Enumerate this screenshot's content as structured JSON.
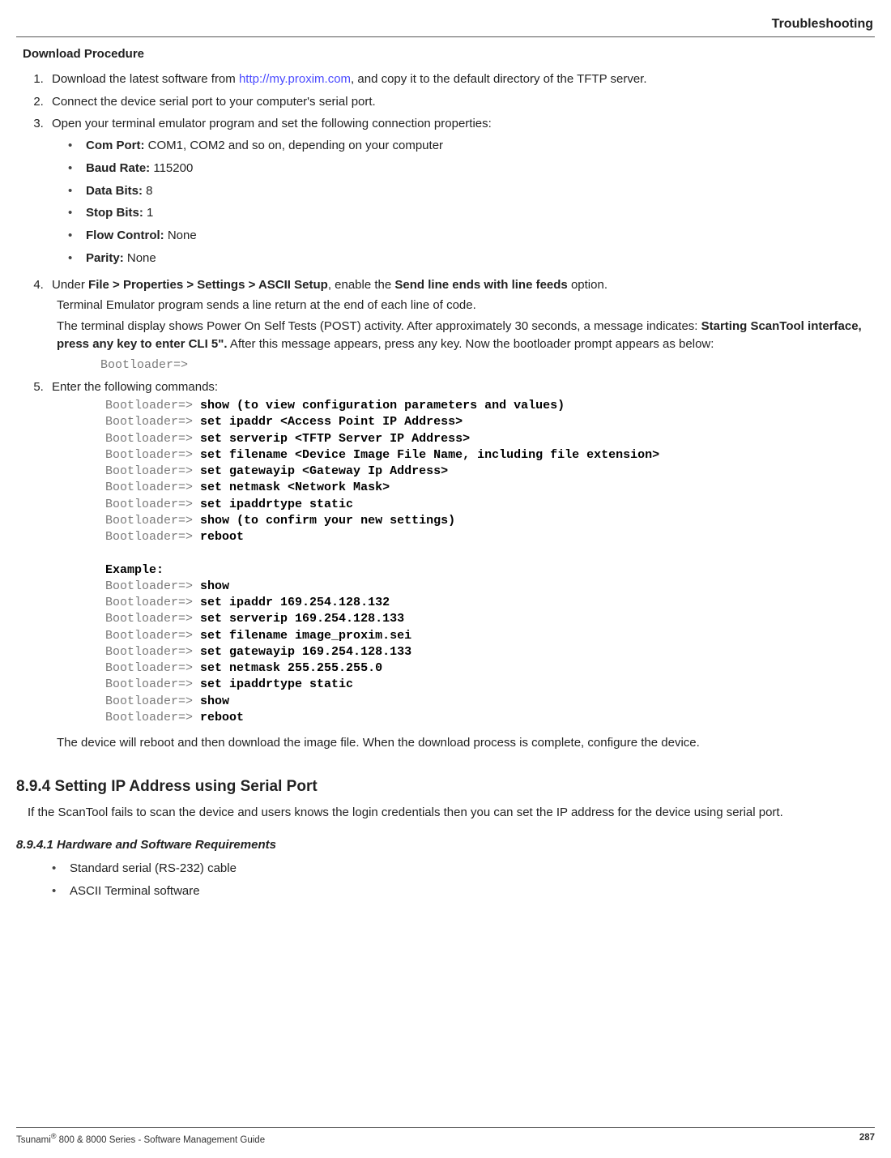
{
  "header": {
    "title": "Troubleshooting"
  },
  "section": {
    "download_procedure_heading": "Download Procedure",
    "step1_pre": "Download the latest software from ",
    "step1_link": "http://my.proxim.com",
    "step1_post": ", and copy it to the default directory of the TFTP server.",
    "step2": "Connect the device serial port to your computer's serial port.",
    "step3": "Open your terminal emulator program and set the following connection properties:",
    "props": {
      "com_port_label": "Com Port:",
      "com_port_val": " COM1, COM2 and so on, depending on your computer",
      "baud_label": "Baud Rate:",
      "baud_val": " 115200",
      "data_bits_label": "Data Bits:",
      "data_bits_val": " 8",
      "stop_bits_label": "Stop Bits:",
      "stop_bits_val": " 1",
      "flow_label": "Flow Control:",
      "flow_val": " None",
      "parity_label": "Parity:",
      "parity_val": " None"
    },
    "step4_pre": "Under ",
    "step4_menu": "File > Properties > Settings > ASCII Setup",
    "step4_mid": ", enable the ",
    "step4_opt": "Send line ends with line feeds",
    "step4_post": " option.",
    "step4_p1": "Terminal Emulator program sends a line return at the end of each line of code.",
    "step4_p2a": "The terminal display shows Power On Self Tests (POST) activity. After approximately 30 seconds, a message indicates: ",
    "step4_p2b": "Starting ScanTool interface, press any key to enter CLI 5\".",
    "step4_p2c": " After this message appears, press any key. Now the bootloader prompt appears as below:",
    "bootloader_prompt": "Bootloader=>",
    "step5": "Enter the following commands:",
    "cmds": [
      {
        "p": "Bootloader=> ",
        "c": "show (to view configuration parameters and values)"
      },
      {
        "p": "Bootloader=> ",
        "c": "set ipaddr <Access Point IP Address>"
      },
      {
        "p": "Bootloader=> ",
        "c": "set serverip <TFTP Server IP Address>"
      },
      {
        "p": "Bootloader=> ",
        "c": "set filename <Device Image File Name, including file extension>"
      },
      {
        "p": "Bootloader=> ",
        "c": "set gatewayip <Gateway Ip Address>"
      },
      {
        "p": "Bootloader=> ",
        "c": "set netmask <Network Mask>"
      },
      {
        "p": "Bootloader=> ",
        "c": "set ipaddrtype static"
      },
      {
        "p": "Bootloader=> ",
        "c": "show (to confirm your new settings)"
      },
      {
        "p": "Bootloader=> ",
        "c": "reboot"
      }
    ],
    "example_label": "Example:",
    "example_cmds": [
      {
        "p": "Bootloader=> ",
        "c": "show"
      },
      {
        "p": "Bootloader=> ",
        "c": "set ipaddr 169.254.128.132"
      },
      {
        "p": "Bootloader=> ",
        "c": "set serverip 169.254.128.133"
      },
      {
        "p": "Bootloader=> ",
        "c": "set filename image_proxim.sei"
      },
      {
        "p": "Bootloader=> ",
        "c": "set gatewayip 169.254.128.133"
      },
      {
        "p": "Bootloader=> ",
        "c": "set netmask 255.255.255.0"
      },
      {
        "p": "Bootloader=> ",
        "c": "set ipaddrtype static"
      },
      {
        "p": "Bootloader=> ",
        "c": "show"
      },
      {
        "p": "Bootloader=> ",
        "c": "reboot"
      }
    ],
    "step5_footer": "The device will reboot and then download the image file. When the download process is complete, configure the device."
  },
  "sec894": {
    "heading": "8.9.4 Setting IP Address using Serial Port",
    "para": "If the ScanTool fails to scan the device and users knows the login credentials then you can set the IP address for the device using serial port.",
    "sub_heading": "8.9.4.1 Hardware and Software Requirements",
    "req1": "Standard serial (RS-232) cable",
    "req2": "ASCII Terminal software"
  },
  "footer": {
    "left_pre": "Tsunami",
    "left_post": " 800 & 8000 Series - Software Management Guide",
    "page": "287"
  }
}
